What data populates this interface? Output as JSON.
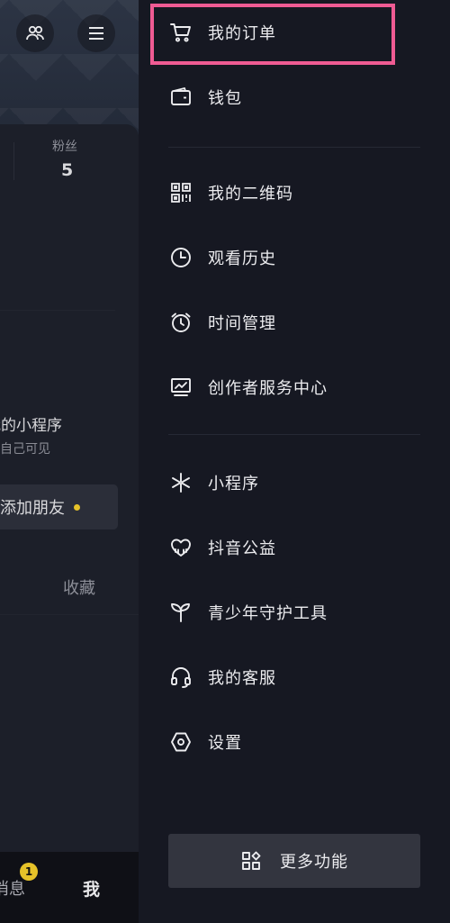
{
  "profile": {
    "fans_label": "粉丝",
    "fans_count": "5",
    "mini_program_title": "我的小程序",
    "mini_program_sub": "仅自己可见",
    "add_friend": "添加朋友",
    "collect_tab": "收藏",
    "bottom_tabs": {
      "messages": "消息",
      "messages_badge": "1",
      "me": "我"
    }
  },
  "drawer": {
    "group1": [
      {
        "label": "我的订单",
        "icon": "cart-icon"
      },
      {
        "label": "钱包",
        "icon": "wallet-icon"
      }
    ],
    "group2": [
      {
        "label": "我的二维码",
        "icon": "qrcode-icon"
      },
      {
        "label": "观看历史",
        "icon": "clock-icon"
      },
      {
        "label": "时间管理",
        "icon": "alarm-icon"
      },
      {
        "label": "创作者服务中心",
        "icon": "monitor-chart-icon"
      }
    ],
    "group3": [
      {
        "label": "小程序",
        "icon": "mini-program-icon"
      },
      {
        "label": "抖音公益",
        "icon": "charity-heart-icon"
      },
      {
        "label": "青少年守护工具",
        "icon": "sprout-icon"
      },
      {
        "label": "我的客服",
        "icon": "headset-icon"
      },
      {
        "label": "设置",
        "icon": "settings-hexagon-icon"
      }
    ],
    "more_button": "更多功能"
  },
  "colors": {
    "highlight": "#ef5b93",
    "badge": "#e6c229",
    "background": "#161822"
  }
}
